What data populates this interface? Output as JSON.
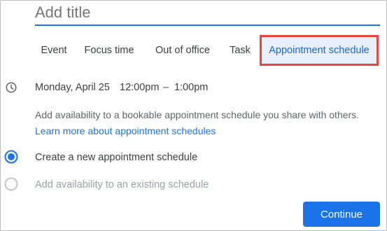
{
  "title_field": {
    "placeholder": "Add title",
    "value": ""
  },
  "tabs": [
    {
      "label": "Event"
    },
    {
      "label": "Focus time"
    },
    {
      "label": "Out of office"
    },
    {
      "label": "Task"
    },
    {
      "label": "Appointment schedule",
      "active": true
    }
  ],
  "schedule": {
    "date": "Monday, April 25",
    "start_time": "12:00pm",
    "separator": "–",
    "end_time": "1:00pm"
  },
  "description": {
    "text": "Add availability to a bookable appointment schedule you share with others.",
    "link": "Learn more about appointment schedules"
  },
  "options": [
    {
      "label": "Create a new appointment schedule",
      "selected": true
    },
    {
      "label": "Add availability to an existing schedule",
      "selected": false,
      "disabled": true
    }
  ],
  "continue_label": "Continue",
  "colors": {
    "accent": "#1a73e8",
    "tab_active_bg": "#e8f0fe",
    "highlight_border": "#e8453c"
  }
}
